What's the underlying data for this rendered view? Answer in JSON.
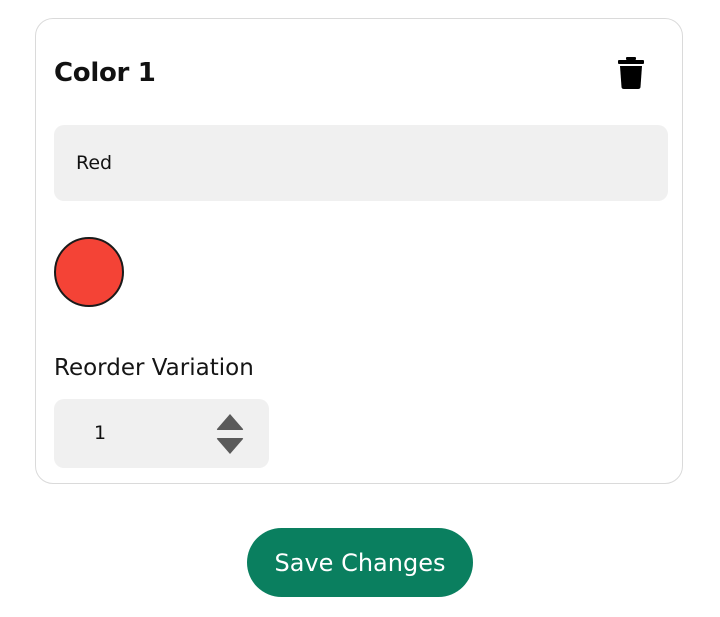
{
  "variation": {
    "title": "Color 1",
    "delete_icon": "trash-icon",
    "name_value": "Red",
    "swatch_color": "#F44336",
    "reorder_label": "Reorder Variation",
    "reorder_value": "1",
    "stepper_up_icon": "triangle-up-icon",
    "stepper_down_icon": "triangle-down-icon"
  },
  "footer": {
    "save_label": "Save Changes",
    "save_color": "#0A7F5F"
  }
}
